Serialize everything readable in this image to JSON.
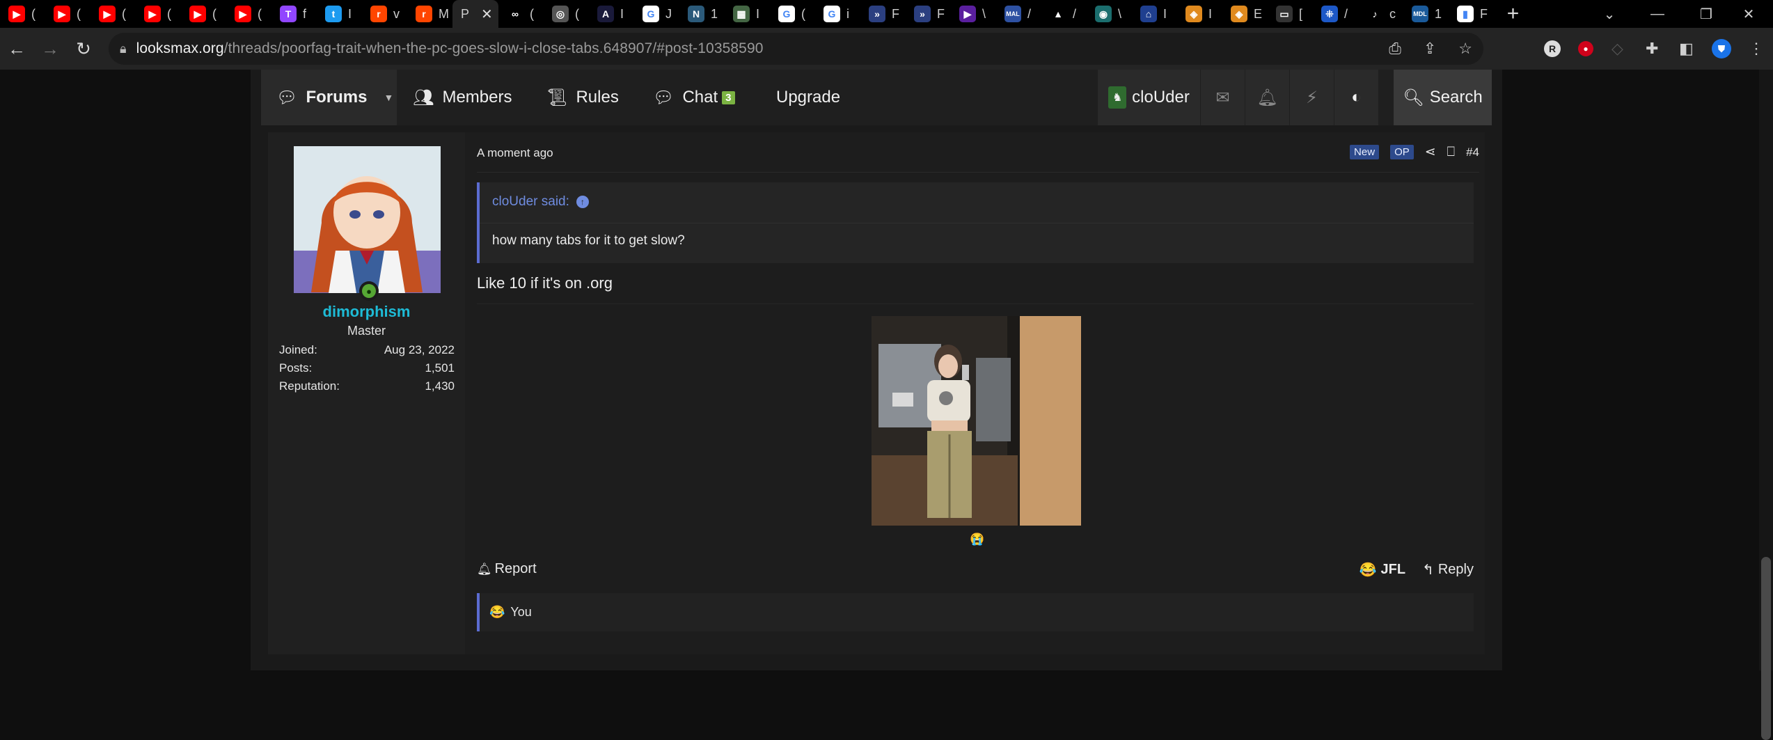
{
  "browser": {
    "tabs": [
      {
        "name": "youtube",
        "label": "(",
        "color": "#ff0000",
        "glyph": "▶"
      },
      {
        "name": "youtube",
        "label": "(",
        "color": "#ff0000",
        "glyph": "▶"
      },
      {
        "name": "youtube",
        "label": "(",
        "color": "#ff0000",
        "glyph": "▶"
      },
      {
        "name": "youtube",
        "label": "(",
        "color": "#ff0000",
        "glyph": "▶"
      },
      {
        "name": "youtube",
        "label": "(",
        "color": "#ff0000",
        "glyph": "▶"
      },
      {
        "name": "youtube",
        "label": "(",
        "color": "#ff0000",
        "glyph": "▶"
      },
      {
        "name": "twitch",
        "label": "f",
        "color": "#9146ff",
        "glyph": "T"
      },
      {
        "name": "twitter",
        "label": "I",
        "color": "#1d9bf0",
        "glyph": "t"
      },
      {
        "name": "reddit",
        "label": "v",
        "color": "#ff4500",
        "glyph": "r"
      },
      {
        "name": "reddit",
        "label": "M",
        "color": "#ff4500",
        "glyph": "r"
      },
      {
        "name": "looksmax",
        "label": "P",
        "color": "#242424",
        "glyph": "",
        "active": true
      },
      {
        "name": "infinity",
        "label": "(",
        "color": "#000000",
        "glyph": "∞"
      },
      {
        "name": "globe",
        "label": "(",
        "color": "#555555",
        "glyph": "◎"
      },
      {
        "name": "letter-a",
        "label": "I",
        "color": "#1a1a3a",
        "glyph": "A"
      },
      {
        "name": "google",
        "label": "J",
        "color": "#ffffff",
        "glyph": "G"
      },
      {
        "name": "letter-n",
        "label": "1",
        "color": "#2b5a7a",
        "glyph": "N"
      },
      {
        "name": "pattern",
        "label": "I",
        "color": "#446644",
        "glyph": "▦"
      },
      {
        "name": "google",
        "label": "(",
        "color": "#ffffff",
        "glyph": "G"
      },
      {
        "name": "google",
        "label": "i",
        "color": "#ffffff",
        "glyph": "G"
      },
      {
        "name": "arrow",
        "label": "F",
        "color": "#2b3f80",
        "glyph": "»"
      },
      {
        "name": "arrow",
        "label": "F",
        "color": "#2b3f80",
        "glyph": "»"
      },
      {
        "name": "play",
        "label": "\\",
        "color": "#5a1f9e",
        "glyph": "▶"
      },
      {
        "name": "mal",
        "label": "/",
        "color": "#2e51a2",
        "glyph": "MAL"
      },
      {
        "name": "triangle",
        "label": "/",
        "color": "#000000",
        "glyph": "▲"
      },
      {
        "name": "earth",
        "label": "\\",
        "color": "#1b6e6e",
        "glyph": "◉"
      },
      {
        "name": "bank",
        "label": "I",
        "color": "#1f3f8f",
        "glyph": "⌂"
      },
      {
        "name": "fox",
        "label": "I",
        "color": "#e08a1e",
        "glyph": "◈"
      },
      {
        "name": "fox",
        "label": "E",
        "color": "#e08a1e",
        "glyph": "◈"
      },
      {
        "name": "window",
        "label": "[",
        "color": "#333333",
        "glyph": "▭"
      },
      {
        "name": "crosshair",
        "label": "/",
        "color": "#1d58c7",
        "glyph": "⁜"
      },
      {
        "name": "tiktok",
        "label": "c",
        "color": "#000000",
        "glyph": "♪"
      },
      {
        "name": "mdl",
        "label": "1",
        "color": "#1a5a9a",
        "glyph": "MDL"
      },
      {
        "name": "bars",
        "label": "F",
        "color": "#ffffff",
        "glyph": "▮"
      }
    ],
    "active_tab_label": "P",
    "url_domain": "looksmax.org",
    "url_path": "/threads/poorfag-trait-when-the-pc-goes-slow-i-close-tabs.648907/#post-10358590"
  },
  "nav": {
    "forums": "Forums",
    "members": "Members",
    "rules": "Rules",
    "chat": "Chat",
    "chat_count": "3",
    "upgrade": "Upgrade",
    "account": "cloUder",
    "search": "Search"
  },
  "post": {
    "user": {
      "name": "dimorphism",
      "title": "Master",
      "stats": [
        {
          "label": "Joined:",
          "value": "Aug 23, 2022"
        },
        {
          "label": "Posts:",
          "value": "1,501"
        },
        {
          "label": "Reputation:",
          "value": "1,430"
        }
      ]
    },
    "time": "A moment ago",
    "badge_new": "New",
    "badge_op": "OP",
    "number": "#4",
    "quote": {
      "author": "cloUder said:",
      "text": "how many tabs for it to get slow?"
    },
    "body": "Like 10 if it's on .org",
    "report": "Report",
    "reaction": "JFL",
    "reply": "Reply",
    "reacted_by": "You"
  },
  "colors": {
    "accent_blue": "#5b6cd1",
    "username": "#1ebbd6",
    "online": "#56a734",
    "chat_badge": "#7bb342"
  }
}
